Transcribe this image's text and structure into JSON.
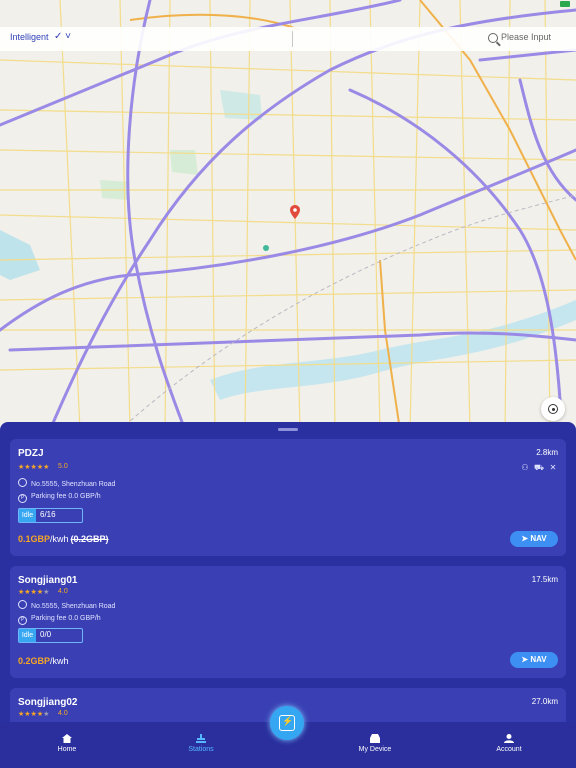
{
  "search": {
    "mode": "Intelligent",
    "placeholder": "Please Input"
  },
  "colors": {
    "sheet": "#2b30a1",
    "card": "#3a40b4",
    "accent": "#3d8ff3",
    "price": "#f6a623",
    "idle": "#38a7f2"
  },
  "map": {
    "pin_icon": "location-pin-icon",
    "locate_icon": "locate-icon"
  },
  "stations": [
    {
      "name": "PDZJ",
      "distance": "2.8km",
      "rating": "5.0",
      "stars": 5,
      "address": "No.5555, Shenzhuan Road",
      "parking": "Parking fee 0.0 GBP/h",
      "status": "Idle",
      "availability": "6/16",
      "price": "0.1GBP",
      "unit": "/kwh",
      "old_price": "(0.2GBP)",
      "nav": "NAV"
    },
    {
      "name": "Songjiang01",
      "distance": "17.5km",
      "rating": "4.0",
      "stars": 4,
      "address": "No.5555, Shenzhuan Road",
      "parking": "Parking fee 0.0 GBP/h",
      "status": "Idle",
      "availability": "0/0",
      "price": "0.2GBP",
      "unit": "/kwh",
      "nav": "NAV"
    },
    {
      "name": "Songjiang02",
      "distance": "27.0km",
      "rating": "4.0",
      "stars": 4
    }
  ],
  "tabs": [
    {
      "label": "Home",
      "icon": "home-icon"
    },
    {
      "label": "Stations",
      "icon": "stations-icon"
    },
    {
      "label": "My Device",
      "icon": "device-icon"
    },
    {
      "label": "Account",
      "icon": "account-icon"
    }
  ],
  "scan_icon": "scan-charge-icon"
}
